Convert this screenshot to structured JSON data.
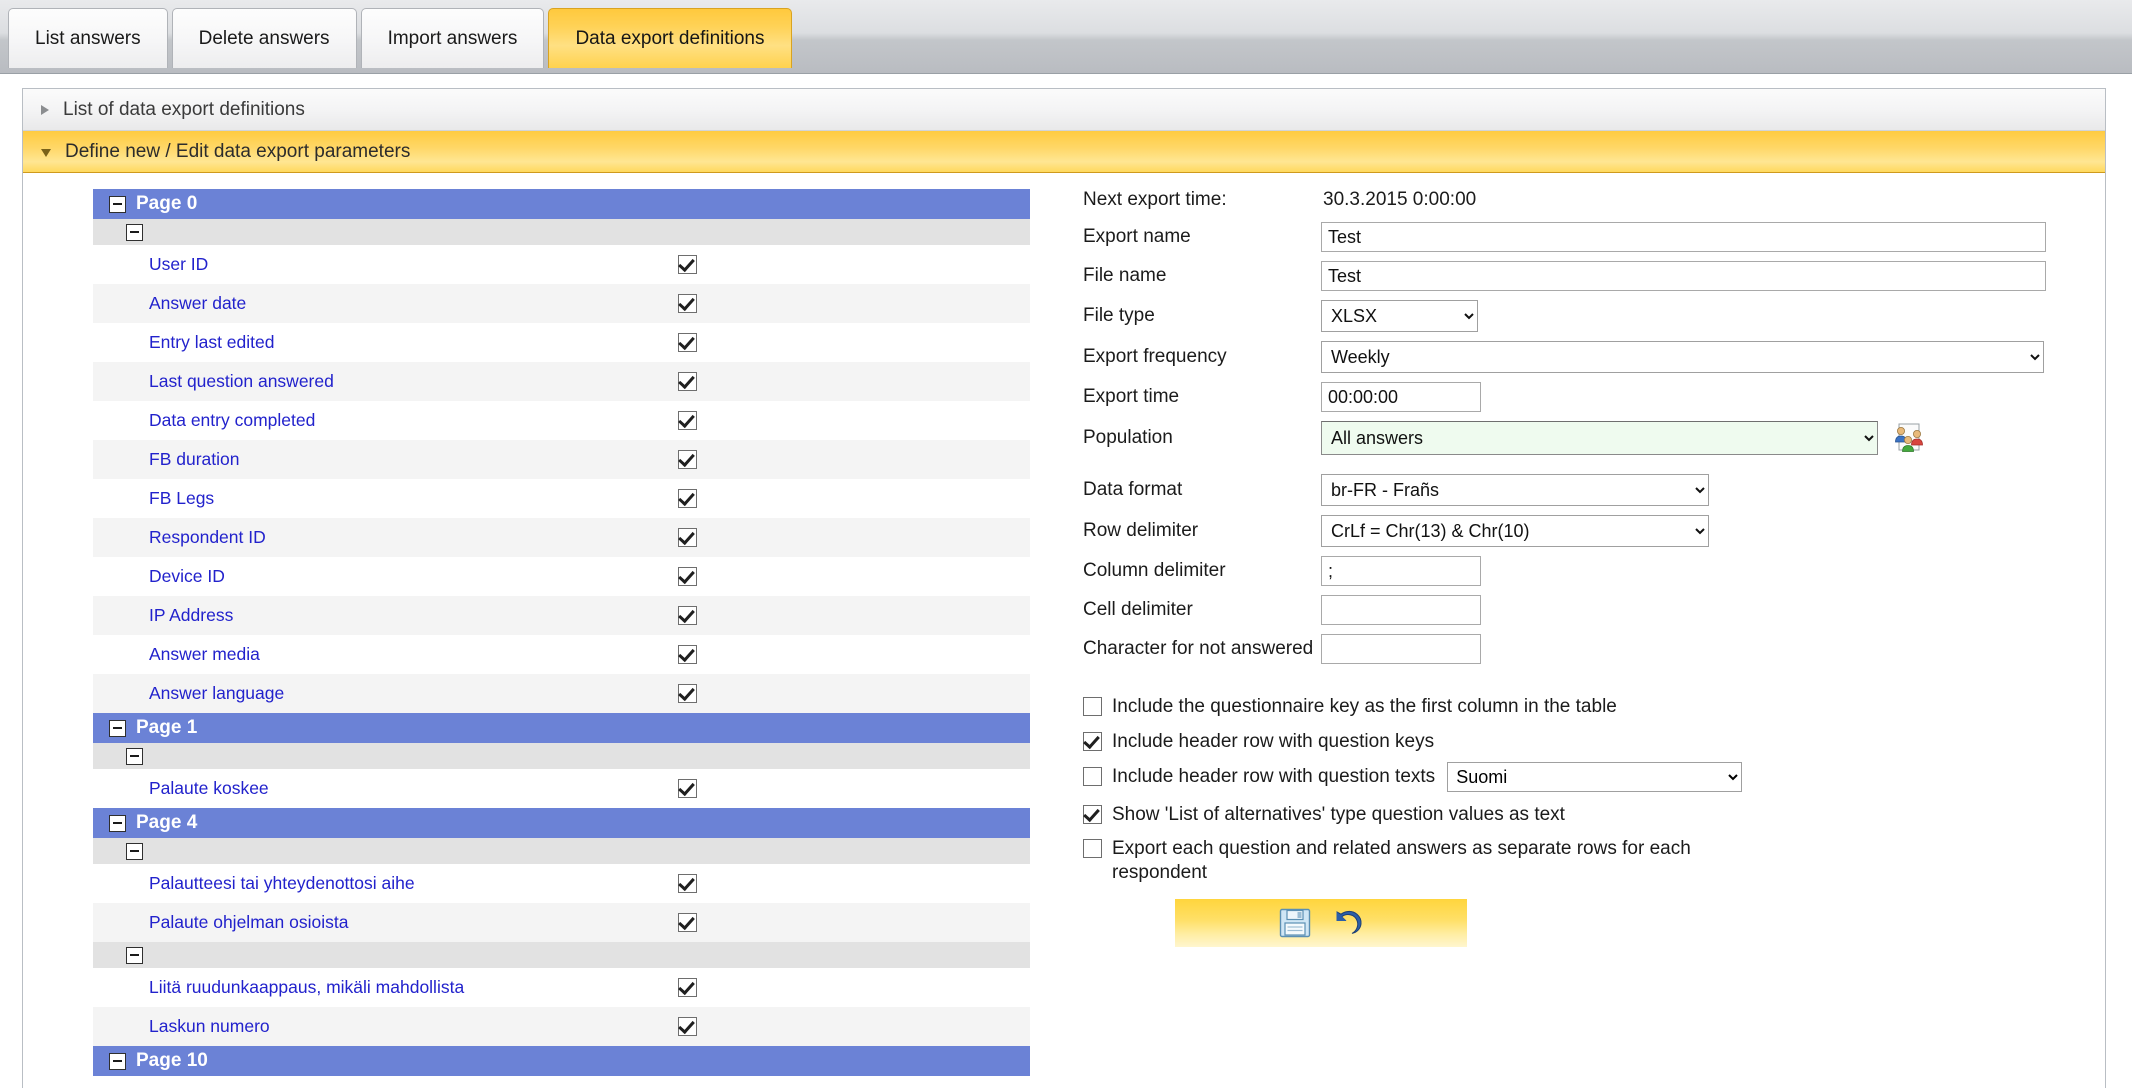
{
  "tabs": [
    {
      "label": "List answers",
      "active": false
    },
    {
      "label": "Delete answers",
      "active": false
    },
    {
      "label": "Import answers",
      "active": false
    },
    {
      "label": "Data export definitions",
      "active": true
    }
  ],
  "accordions": {
    "collapsed_label": "List of data export definitions",
    "expanded_label": "Define new / Edit data export parameters"
  },
  "tree": {
    "rows": [
      {
        "type": "page",
        "label": "Page 0"
      },
      {
        "type": "group",
        "label": ""
      },
      {
        "type": "item",
        "label": "User ID",
        "checked": true
      },
      {
        "type": "item",
        "label": "Answer date",
        "checked": true
      },
      {
        "type": "item",
        "label": "Entry last edited",
        "checked": true
      },
      {
        "type": "item",
        "label": "Last question answered",
        "checked": true
      },
      {
        "type": "item",
        "label": "Data entry completed",
        "checked": true
      },
      {
        "type": "item",
        "label": "FB duration",
        "checked": true
      },
      {
        "type": "item",
        "label": "FB Legs",
        "checked": true
      },
      {
        "type": "item",
        "label": "Respondent ID",
        "checked": true
      },
      {
        "type": "item",
        "label": "Device ID",
        "checked": true
      },
      {
        "type": "item",
        "label": "IP Address",
        "checked": true
      },
      {
        "type": "item",
        "label": "Answer media",
        "checked": true
      },
      {
        "type": "item",
        "label": "Answer language",
        "checked": true
      },
      {
        "type": "page",
        "label": "Page 1"
      },
      {
        "type": "group",
        "label": ""
      },
      {
        "type": "item",
        "label": "Palaute koskee",
        "checked": true
      },
      {
        "type": "page",
        "label": "Page 4"
      },
      {
        "type": "group",
        "label": ""
      },
      {
        "type": "item",
        "label": "Palautteesi tai yhteydenottosi aihe",
        "checked": true
      },
      {
        "type": "item",
        "label": "Palaute ohjelman osioista",
        "checked": true
      },
      {
        "type": "group",
        "label": ""
      },
      {
        "type": "item",
        "label": "Liitä ruudunkaappaus, mikäli mahdollista",
        "checked": true
      },
      {
        "type": "item",
        "label": "Laskun numero",
        "checked": true
      },
      {
        "type": "page",
        "label": "Page 10"
      }
    ]
  },
  "form": {
    "next_export_time_label": "Next export time:",
    "next_export_time_value": "30.3.2015 0:00:00",
    "export_name_label": "Export name",
    "export_name_value": "Test",
    "file_name_label": "File name",
    "file_name_value": "Test",
    "file_type_label": "File type",
    "file_type_value": "XLSX",
    "export_frequency_label": "Export frequency",
    "export_frequency_value": "Weekly",
    "export_time_label": "Export time",
    "export_time_value": "00:00:00",
    "population_label": "Population",
    "population_value": "All answers",
    "data_format_label": "Data format",
    "data_format_value": "br-FR - Frañs",
    "row_delimiter_label": "Row delimiter",
    "row_delimiter_value": "CrLf = Chr(13) & Chr(10)",
    "column_delimiter_label": "Column delimiter",
    "column_delimiter_value": ";",
    "cell_delimiter_label": "Cell delimiter",
    "cell_delimiter_value": "",
    "char_not_answered_label": "Character for not answered",
    "char_not_answered_value": ""
  },
  "options": [
    {
      "label": "Include the questionnaire key as the first column in the table",
      "checked": false
    },
    {
      "label": "Include header row with question keys",
      "checked": true
    },
    {
      "label": "Include header row with question texts",
      "checked": false,
      "select_value": "Suomi"
    },
    {
      "label": "Show 'List of alternatives' type question values as text",
      "checked": true
    },
    {
      "label": "Export each question and related answers as separate rows for each respondent",
      "checked": false
    }
  ],
  "actions": {
    "save_icon": "save-floppy-icon",
    "undo_icon": "undo-arrow-icon"
  },
  "colors": {
    "accent_yellow": "#ffd257",
    "page_header_blue": "#6b82d6",
    "link_blue": "#2222cc",
    "population_green": "#effbef"
  }
}
